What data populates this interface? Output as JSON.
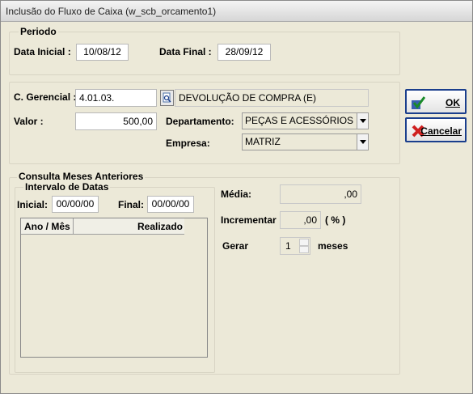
{
  "window": {
    "title": "Inclusão do Fluxo de Caixa (w_scb_orcamento1)"
  },
  "periodo": {
    "group_label": "Periodo",
    "data_inicial_label": "Data Inicial :",
    "data_inicial_value": "10/08/12",
    "data_final_label": "Data Final :",
    "data_final_value": "28/09/12"
  },
  "form": {
    "c_gerencial_label": "C. Gerencial :",
    "c_gerencial_value": "4.01.03.",
    "c_gerencial_desc": "DEVOLUÇÃO DE COMPRA (E)",
    "valor_label": "Valor :",
    "valor_value": "500,00",
    "departamento_label": "Departamento:",
    "departamento_value": "PEÇAS E ACESSÓRIOS",
    "empresa_label": "Empresa:",
    "empresa_value": "MATRIZ"
  },
  "buttons": {
    "ok_label": "OK",
    "cancelar_label": "Cancelar"
  },
  "consulta": {
    "group_label": "Consulta Meses Anteriores",
    "intervalo_label": "Intervalo de Datas",
    "inicial_label": "Inicial:",
    "inicial_value": "00/00/00",
    "final_label": "Final:",
    "final_value": "00/00/00",
    "columns": [
      "Ano / Mês",
      "Realizado"
    ],
    "media_label": "Média:",
    "media_value": ",00",
    "incrementar_label": "Incrementar",
    "incrementar_value": ",00",
    "pct_label": "( % )",
    "gerar_label": "Gerar",
    "gerar_value": "1",
    "meses_label": "meses"
  }
}
